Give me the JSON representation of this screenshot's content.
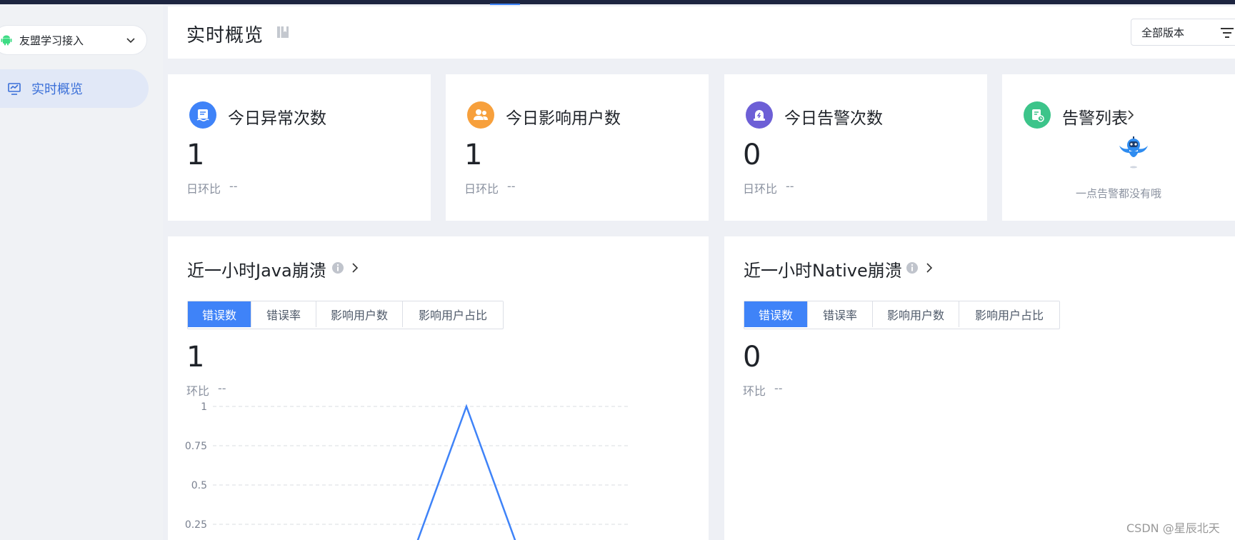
{
  "app": {
    "selected_app": "友盟学习接入"
  },
  "sidebar": {
    "items": [
      {
        "label": "实时概览",
        "icon": "monitor-icon",
        "active": true
      }
    ]
  },
  "header": {
    "title": "实时概览",
    "book_icon": "book-icon",
    "version_select": "全部版本"
  },
  "stats": [
    {
      "title": "今日异常次数",
      "value": "1",
      "ratio_label": "日环比",
      "ratio_value": "--",
      "icon": "report-icon",
      "color": "#3f83f8"
    },
    {
      "title": "今日影响用户数",
      "value": "1",
      "ratio_label": "日环比",
      "ratio_value": "--",
      "icon": "users-icon",
      "color": "#f7a03c"
    },
    {
      "title": "今日告警次数",
      "value": "0",
      "ratio_label": "日环比",
      "ratio_value": "--",
      "icon": "alarm-icon",
      "color": "#6d5fd6"
    }
  ],
  "alert_list": {
    "title": "告警列表",
    "empty_text": "一点告警都没有哦",
    "icon": "alert-list-icon",
    "color": "#3cc48a"
  },
  "panels": [
    {
      "title": "近一小时Java崩溃",
      "tabs": [
        "错误数",
        "错误率",
        "影响用户数",
        "影响用户占比"
      ],
      "active_tab": 0,
      "value": "1",
      "ratio_label": "环比",
      "ratio_value": "--"
    },
    {
      "title": "近一小时Native崩溃",
      "tabs": [
        "错误数",
        "错误率",
        "影响用户数",
        "影响用户占比"
      ],
      "active_tab": 0,
      "value": "0",
      "ratio_label": "环比",
      "ratio_value": "--"
    }
  ],
  "chart_data": {
    "type": "line",
    "title": "",
    "xlabel": "",
    "ylabel": "",
    "y_ticks": [
      "1",
      "0.75",
      "0.5",
      "0.25"
    ],
    "ylim": [
      0,
      1
    ],
    "grid": true,
    "line_color": "#3f83f8",
    "series": [
      {
        "values": [
          0,
          1,
          0
        ]
      }
    ]
  },
  "watermark": "CSDN @星辰北天"
}
